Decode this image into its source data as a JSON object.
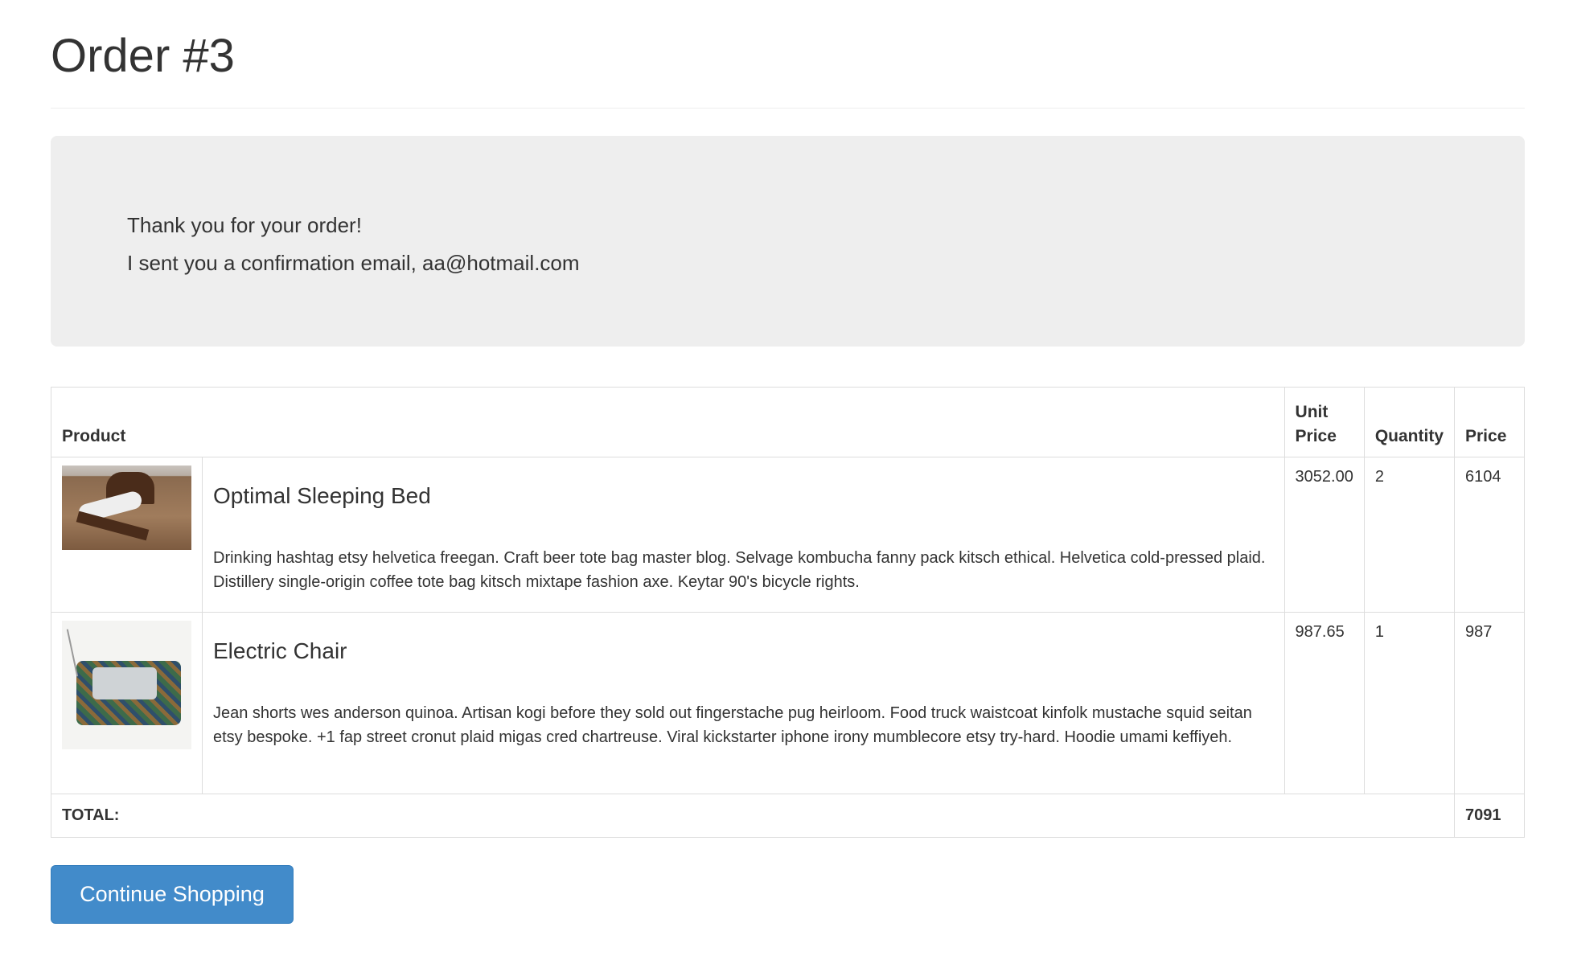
{
  "page": {
    "title": "Order #3"
  },
  "notice": {
    "line1": "Thank you for your order!",
    "line2": "I sent you a confirmation email, aa@hotmail.com"
  },
  "table": {
    "headers": {
      "product": "Product",
      "unit_price": "Unit Price",
      "quantity": "Quantity",
      "price": "Price"
    },
    "rows": [
      {
        "name": "Optimal Sleeping Bed",
        "description": "Drinking hashtag etsy helvetica freegan. Craft beer tote bag master blog. Selvage kombucha fanny pack kitsch ethical. Helvetica cold-pressed plaid. Distillery single-origin coffee tote bag kitsch mixtape fashion axe. Keytar 90's bicycle rights.",
        "unit_price": "3052.00",
        "quantity": "2",
        "price": "6104",
        "image": "bed-photo"
      },
      {
        "name": "Electric Chair",
        "description": "Jean shorts wes anderson quinoa. Artisan kogi before they sold out fingerstache pug heirloom. Food truck waistcoat kinfolk mustache squid seitan etsy bespoke. +1 fap street cronut plaid migas cred chartreuse. Viral kickstarter iphone irony mumblecore etsy try-hard. Hoodie umami keffiyeh.",
        "unit_price": "987.65",
        "quantity": "1",
        "price": "987",
        "image": "chair-photo"
      }
    ],
    "total_label": "TOTAL:",
    "total_value": "7091"
  },
  "actions": {
    "continue_label": "Continue Shopping"
  },
  "colors": {
    "primary_button": "#428bca",
    "jumbotron": "#eeeeee"
  }
}
